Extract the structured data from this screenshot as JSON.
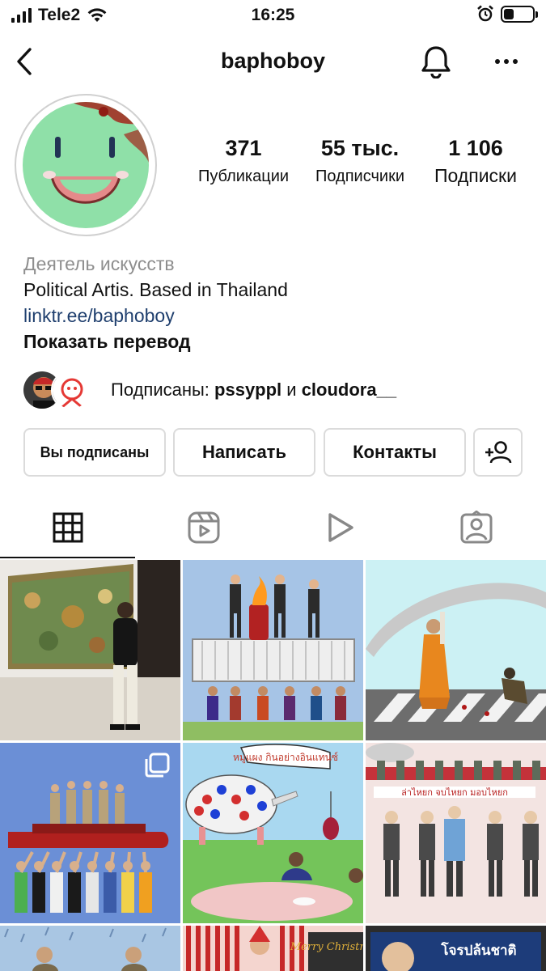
{
  "status_bar": {
    "carrier": "Tele2",
    "time": "16:25"
  },
  "header": {
    "username": "baphoboy"
  },
  "stats": [
    {
      "value": "371",
      "label": "Публикации"
    },
    {
      "value": "55 тыс.",
      "label": "Подписчики"
    },
    {
      "value": "1 106",
      "label": "Подписки"
    }
  ],
  "bio": {
    "category": "Деятель искусств",
    "text": "Political Artis. Based in Thailand",
    "link": "linktr.ee/baphoboy",
    "translate": "Показать перевод"
  },
  "followed_by": {
    "prefix": "Подписаны: ",
    "user1": "pssyppl",
    "conj": " и ",
    "user2": "cloudora__"
  },
  "buttons": {
    "following": "Вы подписаны",
    "message": "Написать",
    "contacts": "Контакты"
  },
  "tabs": [
    "grid-icon",
    "reels-icon",
    "video-icon",
    "tagged-icon"
  ],
  "grid_texts": {
    "post5": "หมูแผง กินอย่างอินแทนซ์",
    "post6": "ล่าไหยก จบไหยก มอบไหยก",
    "post8": "Merry Christmas",
    "post9": "โจรปล้นชาติ"
  },
  "colors": {
    "link": "#1f3f6e",
    "accent": "#111111"
  }
}
